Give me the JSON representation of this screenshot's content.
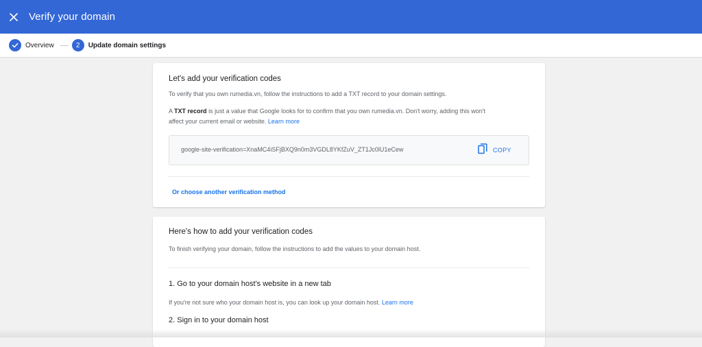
{
  "appbar": {
    "title": "Verify your domain",
    "close_icon": "close-icon",
    "color": "#3367d6"
  },
  "stepper": {
    "steps": [
      {
        "label": "Overview",
        "state": "completed",
        "icon": "check-icon"
      },
      {
        "label": "Update domain settings",
        "number": "2",
        "state": "active"
      }
    ]
  },
  "card1": {
    "heading": "Let's add your verification codes",
    "intro": "To verify that you own rumedia.vn, follow the instructions to add a TXT record to your domain settings.",
    "txt_prefix": "A",
    "txt_bold": "TXT record",
    "txt_rest_line1": "is just a value that Google looks for to confirm that you own rumedia.vn. Don't worry, adding this won't",
    "txt_rest_line2": "affect your current email or website.",
    "learn_more": "Learn more",
    "code": "google-site-verification=XnaMC4iSFjBXQ9n0m3VGDL8YKfZuV_ZT1Jc0lU1eCew",
    "copy_label": "COPY",
    "copy_icon": "copy-icon",
    "alt_method": "Or choose another verification method"
  },
  "card2": {
    "heading": "Here's how to add your verification codes",
    "intro": "To finish verifying your domain, follow the instructions to add the values to your domain host.",
    "step1_title": "1. Go to your domain host's website in a new tab",
    "step1_text": "If you're not sure who your domain host is, you can look up your domain host.",
    "step1_link": "Learn more",
    "step2_title": "2. Sign in to your domain host"
  },
  "colors": {
    "primary": "#3367d6",
    "link": "#1a73e8",
    "background": "#f1f1f1"
  }
}
